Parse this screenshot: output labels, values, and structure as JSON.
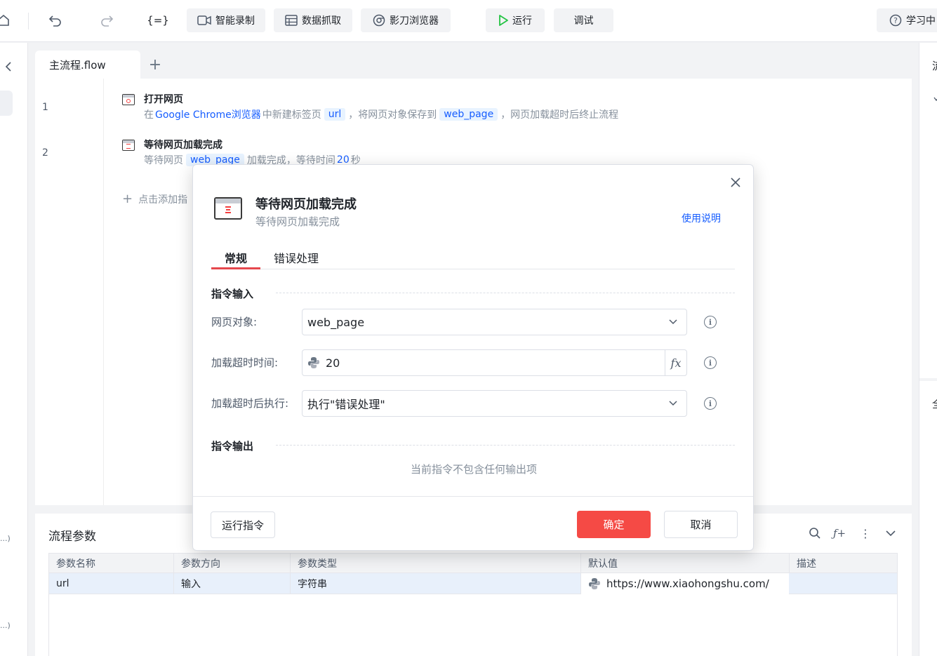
{
  "toolbar": {
    "smart_record": "智能录制",
    "data_capture": "数据抓取",
    "browser": "影刀浏览器",
    "run": "运行",
    "debug": "调试",
    "learn": "学习中"
  },
  "tabs": [
    {
      "label": "主流程.flow"
    }
  ],
  "steps": [
    {
      "line": "1",
      "title": "打开网页",
      "desc": {
        "t1": "在",
        "kw": "Google Chrome浏览器",
        "t2": "中新建标签页",
        "chip1": "url",
        "t3": "，将网页对象保存到",
        "chip2": "web_page",
        "t4": "，网页加载超时后终止流程"
      }
    },
    {
      "line": "2",
      "title": "等待网页加载完成",
      "desc": {
        "t1": "等待网页",
        "chip1": "web_page",
        "t2": "加载完成，等待时间",
        "kw": "20",
        "t3": "秒"
      }
    }
  ],
  "add_command": "点击添加指",
  "left_strip": {
    "trunc1": "...)",
    "trunc2": "...)"
  },
  "right_strip": {
    "ch1": "流",
    "ch2": "全"
  },
  "params": {
    "title": "流程参数",
    "columns": [
      "参数名称",
      "参数方向",
      "参数类型",
      "默认值",
      "描述"
    ],
    "rows": [
      {
        "name": "url",
        "direction": "输入",
        "type": "字符串",
        "default": "https://www.xiaohongshu.com/",
        "desc": ""
      }
    ]
  },
  "dialog": {
    "title": "等待网页加载完成",
    "subtitle": "等待网页加载完成",
    "help": "使用说明",
    "tabs": [
      "常规",
      "错误处理"
    ],
    "section_input": "指令输入",
    "fields": [
      {
        "label": "网页对象:",
        "value": "web_page"
      },
      {
        "label": "加载超时时间:",
        "value": "20"
      },
      {
        "label": "加载超时后执行:",
        "value": "执行\"错误处理\""
      }
    ],
    "section_output": "指令输出",
    "no_output": "当前指令不包含任何输出项",
    "run_button": "运行指令",
    "ok_button": "确定",
    "cancel_button": "取消"
  },
  "colors": {
    "accent": "#165dff",
    "danger": "#f54a45",
    "run_green": "#23c343"
  }
}
